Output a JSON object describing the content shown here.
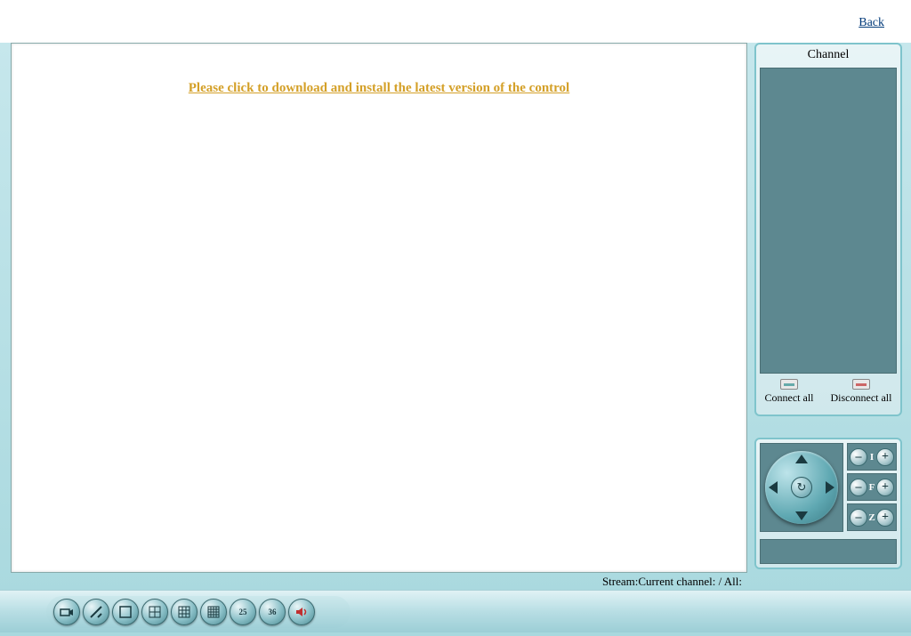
{
  "header": {
    "back_label": "Back"
  },
  "main": {
    "download_prompt": "Please click to download and install the latest version of the control"
  },
  "sidebar": {
    "channel_title": "Channel",
    "connect_all_label": "Connect all",
    "disconnect_all_label": "Disconnect all"
  },
  "ptz": {
    "iris_label": "I",
    "focus_label": "F",
    "zoom_label": "Z",
    "minus": "–",
    "plus": "+",
    "center": "↻"
  },
  "toolbar": {
    "grid25_label": "25",
    "grid36_label": "36"
  },
  "status": {
    "stream_text": "Stream:Current channel: / All:"
  }
}
